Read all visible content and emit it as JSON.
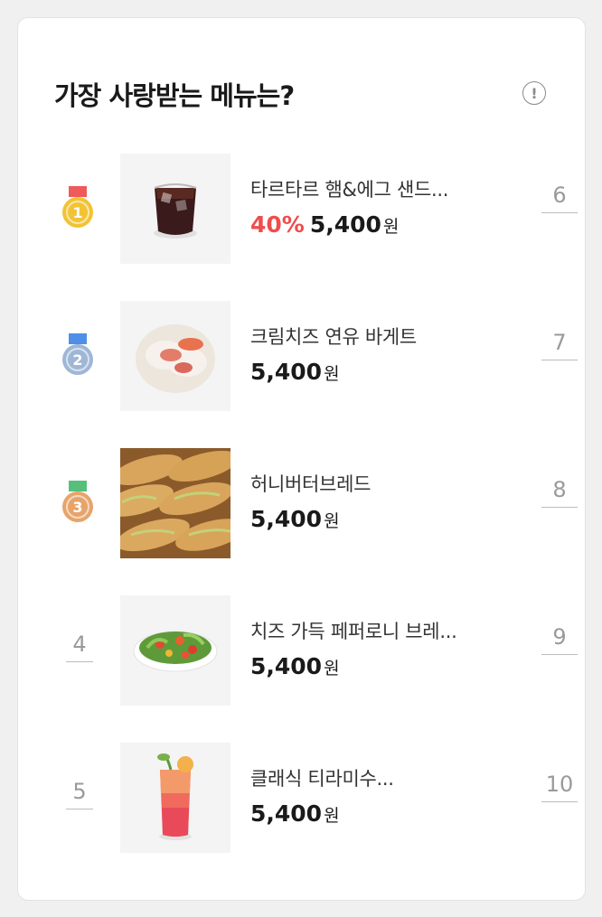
{
  "header": {
    "title": "가장 사랑받는 메뉴는?",
    "info_label": "!"
  },
  "colors": {
    "discount": "#ef4d4d",
    "gold": "#f2c335",
    "silver": "#9fb7d6",
    "bronze": "#e7a46a",
    "ribbon_red": "#ef5a5a",
    "ribbon_blue": "#4f8fe8",
    "ribbon_green": "#56c07b"
  },
  "items": [
    {
      "rank": "1",
      "name": "타르타르 햄&에그 샌드...",
      "discount": "40%",
      "price": "5,400",
      "unit": "원",
      "image": "iced-americano-icon",
      "right_rank": "6"
    },
    {
      "rank": "2",
      "name": "크림치즈 연유 바게트",
      "discount": "",
      "price": "5,400",
      "unit": "원",
      "image": "cream-cheese-baguette-icon",
      "right_rank": "7"
    },
    {
      "rank": "3",
      "name": "허니버터브레드",
      "discount": "",
      "price": "5,400",
      "unit": "원",
      "image": "honey-butter-bread-icon",
      "right_rank": "8"
    },
    {
      "rank": "4",
      "name": "치즈 가득 페퍼로니 브레...",
      "discount": "",
      "price": "5,400",
      "unit": "원",
      "image": "salad-icon",
      "right_rank": "9"
    },
    {
      "rank": "5",
      "name": "클래식 티라미수...",
      "discount": "",
      "price": "5,400",
      "unit": "원",
      "image": "fruit-ade-icon",
      "right_rank": "10"
    }
  ]
}
